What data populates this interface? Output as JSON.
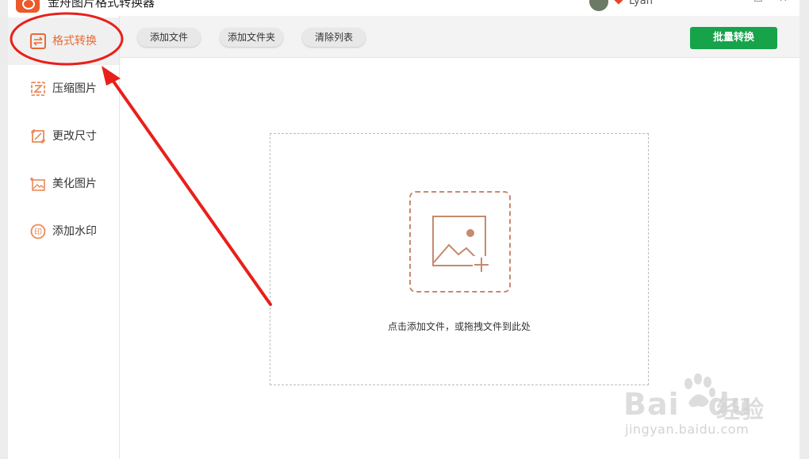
{
  "app": {
    "title": "金舟图片格式转换器",
    "user_name": "Lyan",
    "minimize_glyph": "—",
    "maximize_glyph": "☐",
    "close_glyph": "✕"
  },
  "sidebar": {
    "items": [
      {
        "label": "格式转换",
        "icon": "convert-icon",
        "active": true
      },
      {
        "label": "压缩图片",
        "icon": "compress-icon",
        "active": false
      },
      {
        "label": "更改尺寸",
        "icon": "resize-icon",
        "active": false
      },
      {
        "label": "美化图片",
        "icon": "beautify-icon",
        "active": false
      },
      {
        "label": "添加水印",
        "icon": "watermark-icon",
        "active": false
      }
    ]
  },
  "toolbar": {
    "add_file": "添加文件",
    "add_folder": "添加文件夹",
    "clear_list": "清除列表",
    "batch_convert": "批量转换"
  },
  "main": {
    "drop_hint": "点击添加文件，或拖拽文件到此处"
  },
  "watermark": {
    "brand": "Bai",
    "brand2": "du",
    "jingyan": "经验",
    "url": "jingyan.baidu.com"
  },
  "colors": {
    "accent": "#e96a36",
    "batch_button": "#16a34a",
    "annotation_red": "#e8201a",
    "upload_border": "#c58a6f"
  }
}
